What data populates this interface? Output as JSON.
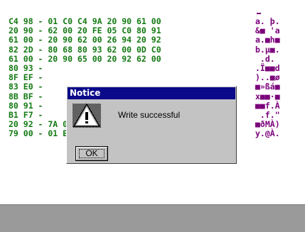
{
  "hex_rows": [
    "C4 98 - 01 C0 C4 9A 20 90 61 00",
    "20 90 - 62 00 20 FE 05 C0 80 91",
    "61 00 - 20 90 62 00 26 94 20 92",
    "82 2D - 80 68 80 93 62 00 0D C0",
    "61 00 - 20 90 65 00 20 92 62 00",
    "80 93 -",
    "8F EF -",
    "83 E0 -",
    "8B BF -",
    "80 91 -",
    "B1 F7 -",
    "20 92 - 7A 00 C0 9A 22 24 20 92",
    "79 00 - 01 E0 C9 D0 20 90 7A 00"
  ],
  "ascii_rows": [
    "a. þ.",
    "&■ 'a",
    "a.■h■",
    "b.µ■.",
    " .d. ",
    ".Ï■■d",
    ")..■ø",
    "■»ßá■",
    "x■■·■",
    "■■f.À",
    " .f.\"",
    "■ðMÀ)",
    "y.@À."
  ],
  "dialog": {
    "title": "Notice",
    "message": "Write successful",
    "ok_label": "OK",
    "icon": "warning-icon"
  },
  "colors": {
    "hex_text": "#147a14",
    "ascii_text": "#7a007a",
    "title_bar": "#0a0a8a",
    "dialog_face": "#c3c3c3",
    "status_bar": "#9a9a9a"
  }
}
